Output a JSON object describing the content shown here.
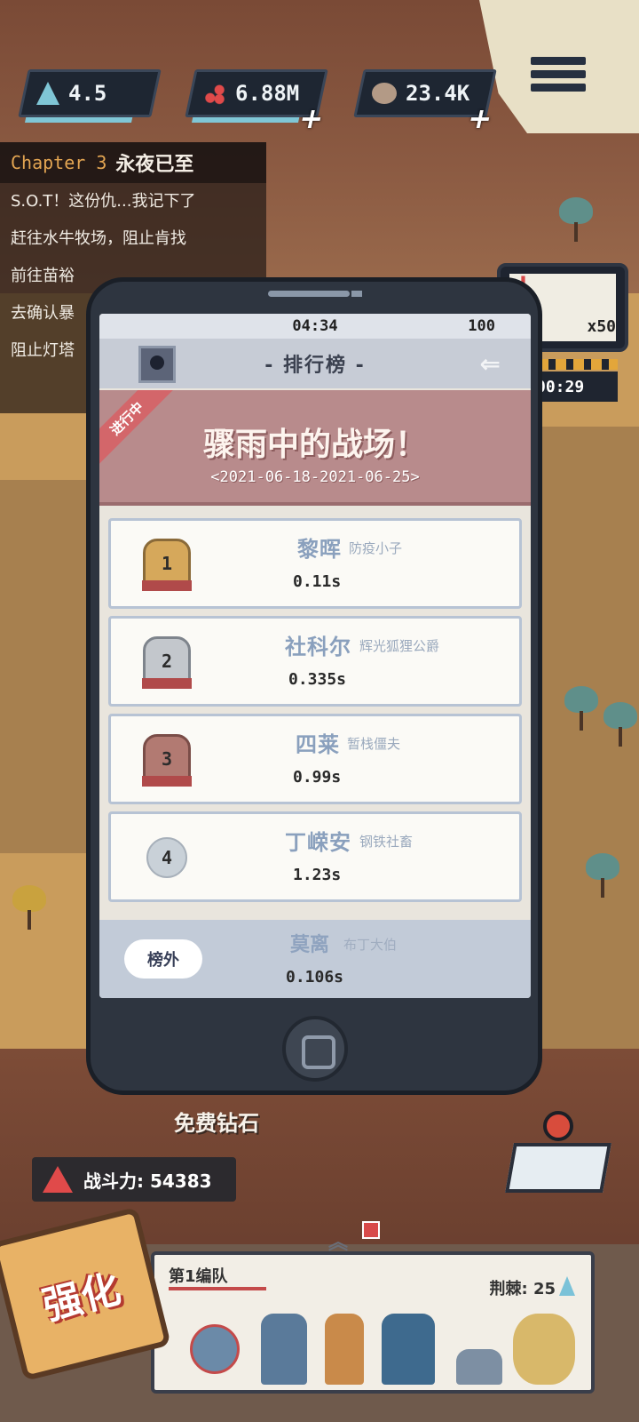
{
  "resources": [
    {
      "icon": "crystal-icon",
      "value": "4.5"
    },
    {
      "icon": "gem-cluster-icon",
      "value": "6.88M"
    },
    {
      "icon": "ore-icon",
      "value": "23.4K"
    }
  ],
  "quest": {
    "chapter_num": "Chapter 3",
    "chapter_name": "永夜已至",
    "items": [
      "S.O.T！这份仇...我记下了",
      "赶往水牛牧场，阻止肯找",
      "前往苗裕",
      "去确认暴",
      "阻止灯塔"
    ]
  },
  "phone": {
    "status_time": "04:34",
    "status_battery": "100",
    "title": "- 排行榜 -",
    "event": {
      "ribbon": "进行中",
      "name": "骤雨中的战场！",
      "dates": "<2021-06-18-2021-06-25>"
    },
    "rows": [
      {
        "rank": "1",
        "name": "黎晖",
        "title": "防疫小子",
        "time": "0.11s"
      },
      {
        "rank": "2",
        "name": "社科尔",
        "title": "辉光狐狸公爵",
        "time": "0.335s"
      },
      {
        "rank": "3",
        "name": "四莱",
        "title": "暂栈僵夫",
        "time": "0.99s"
      },
      {
        "rank": "4",
        "name": "丁嵘安",
        "title": "钢铁社畜",
        "time": "1.23s"
      }
    ],
    "mine": {
      "tag": "榜外",
      "name": "莫离",
      "title": "布丁大伯",
      "time": "0.106s"
    }
  },
  "side_widget": {
    "multiplier": "x50",
    "timer": "00:29",
    "alert": "!"
  },
  "bottom": {
    "free_diamond": "免费钻石",
    "power_label": "战斗力: 54383",
    "team_name": "第1编队",
    "capacity": "荆棘: 25",
    "upgrade": "强化"
  },
  "colors": {
    "accent": "#b88b8c",
    "hud_dark": "#1e2632",
    "warn": "#e04a4a"
  }
}
